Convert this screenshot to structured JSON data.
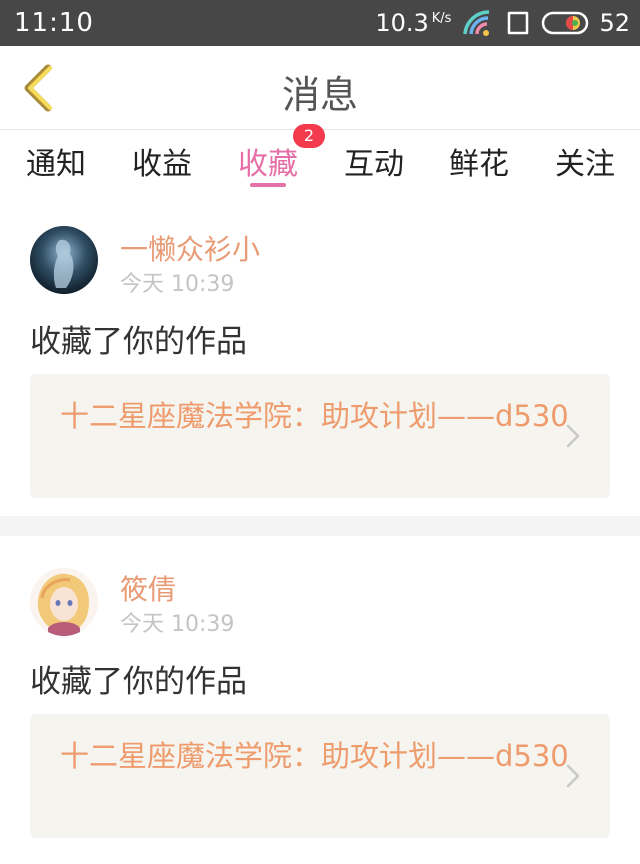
{
  "status_bar": {
    "time": "11:10",
    "speed": "10.3",
    "speed_unit": "K/s",
    "battery": "52",
    "icons": [
      "wifi-icon",
      "sim-icon",
      "battery-toggle-icon"
    ]
  },
  "header": {
    "title": "消息",
    "back_icon": "chevron-left-icon"
  },
  "tabs": [
    {
      "label": "通知"
    },
    {
      "label": "收益"
    },
    {
      "label": "收藏",
      "active": true,
      "badge": "2"
    },
    {
      "label": "互动"
    },
    {
      "label": "鲜花"
    },
    {
      "label": "关注"
    }
  ],
  "messages": [
    {
      "username": "一懒众衫小",
      "time": "今天 10:39",
      "action": "收藏了你的作品",
      "work_title": "十二星座魔法学院：助攻计划——d530"
    },
    {
      "username": "筱倩",
      "time": "今天 10:39",
      "action": "收藏了你的作品",
      "work_title": "十二星座魔法学院：助攻计划——d530"
    }
  ],
  "colors": {
    "accent": "#e470a7",
    "username": "#e89b74",
    "work_title": "#ee9b6d",
    "badge": "#f43a4d",
    "status_bar": "#474747"
  }
}
